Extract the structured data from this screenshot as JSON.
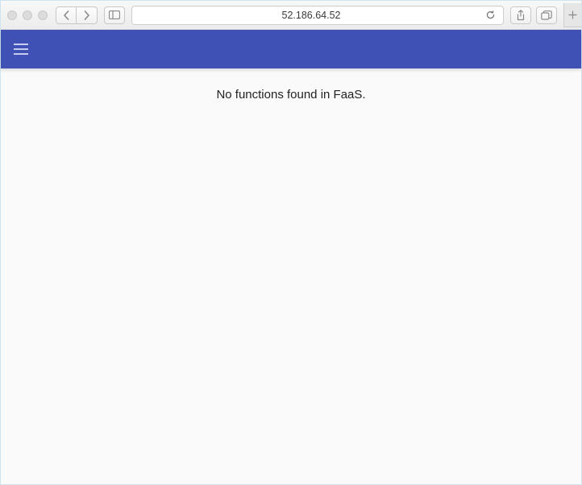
{
  "browser": {
    "address": "52.186.64.52"
  },
  "app": {
    "empty_state_message": "No functions found in FaaS."
  }
}
